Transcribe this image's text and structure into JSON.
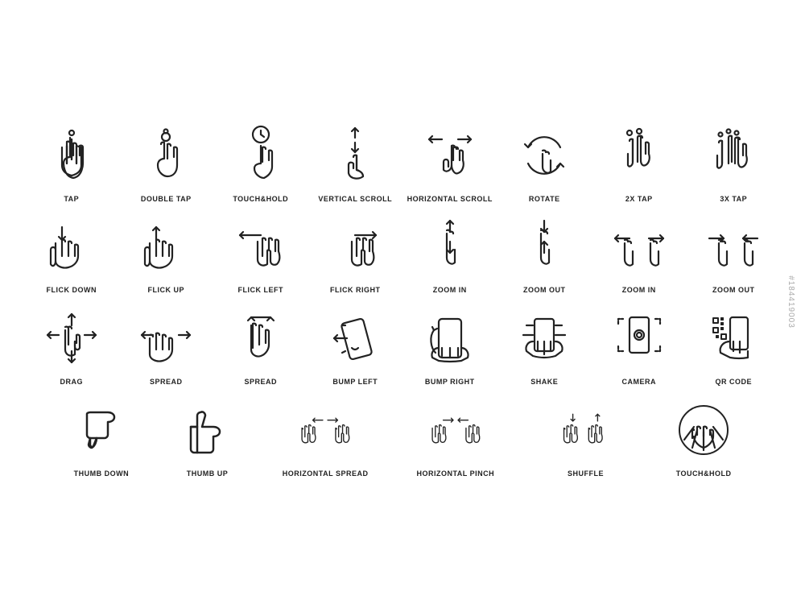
{
  "rows": [
    {
      "items": [
        {
          "label": "TAP",
          "icon": "tap"
        },
        {
          "label": "DOUBLE TAP",
          "icon": "double-tap"
        },
        {
          "label": "TOUCH&HOLD",
          "icon": "touch-hold"
        },
        {
          "label": "VERTICAL\nSCROLL",
          "icon": "vertical-scroll"
        },
        {
          "label": "HORIZONTAL\nSCROLL",
          "icon": "horizontal-scroll"
        },
        {
          "label": "ROTATE",
          "icon": "rotate"
        },
        {
          "label": "2X TAP",
          "icon": "2x-tap"
        },
        {
          "label": "3X TAP",
          "icon": "3x-tap"
        }
      ]
    },
    {
      "items": [
        {
          "label": "FLICK DOWN",
          "icon": "flick-down"
        },
        {
          "label": "FLICK UP",
          "icon": "flick-up"
        },
        {
          "label": "FLICK LEFT",
          "icon": "flick-left"
        },
        {
          "label": "FLICK RIGHT",
          "icon": "flick-right"
        },
        {
          "label": "ZOOM IN",
          "icon": "zoom-in-1"
        },
        {
          "label": "ZOOM OUT",
          "icon": "zoom-out-1"
        },
        {
          "label": "ZOOM IN",
          "icon": "zoom-in-2"
        },
        {
          "label": "ZOOM OUT",
          "icon": "zoom-out-2"
        }
      ]
    },
    {
      "items": [
        {
          "label": "DRAG",
          "icon": "drag"
        },
        {
          "label": "SPREAD",
          "icon": "spread-1"
        },
        {
          "label": "SPREAD",
          "icon": "spread-2"
        },
        {
          "label": "BUMP LEFT",
          "icon": "bump-left"
        },
        {
          "label": "BUMP RIGHT",
          "icon": "bump-right"
        },
        {
          "label": "SHAKE",
          "icon": "shake"
        },
        {
          "label": "CAMERA",
          "icon": "camera"
        },
        {
          "label": "QR CODE",
          "icon": "qr-code"
        }
      ]
    },
    {
      "items": [
        {
          "label": "THUMB DOWN",
          "icon": "thumb-down"
        },
        {
          "label": "THUMB UP",
          "icon": "thumb-up"
        },
        {
          "label": "HORIZONTAL SPREAD",
          "icon": "horizontal-spread"
        },
        {
          "label": "HORIZONTAL PINCH",
          "icon": "horizontal-pinch"
        },
        {
          "label": "SHUFFLE",
          "icon": "shuffle"
        },
        {
          "label": "TOUCH&HOLD",
          "icon": "touch-hold-2"
        }
      ]
    }
  ],
  "watermark": "#184419003"
}
